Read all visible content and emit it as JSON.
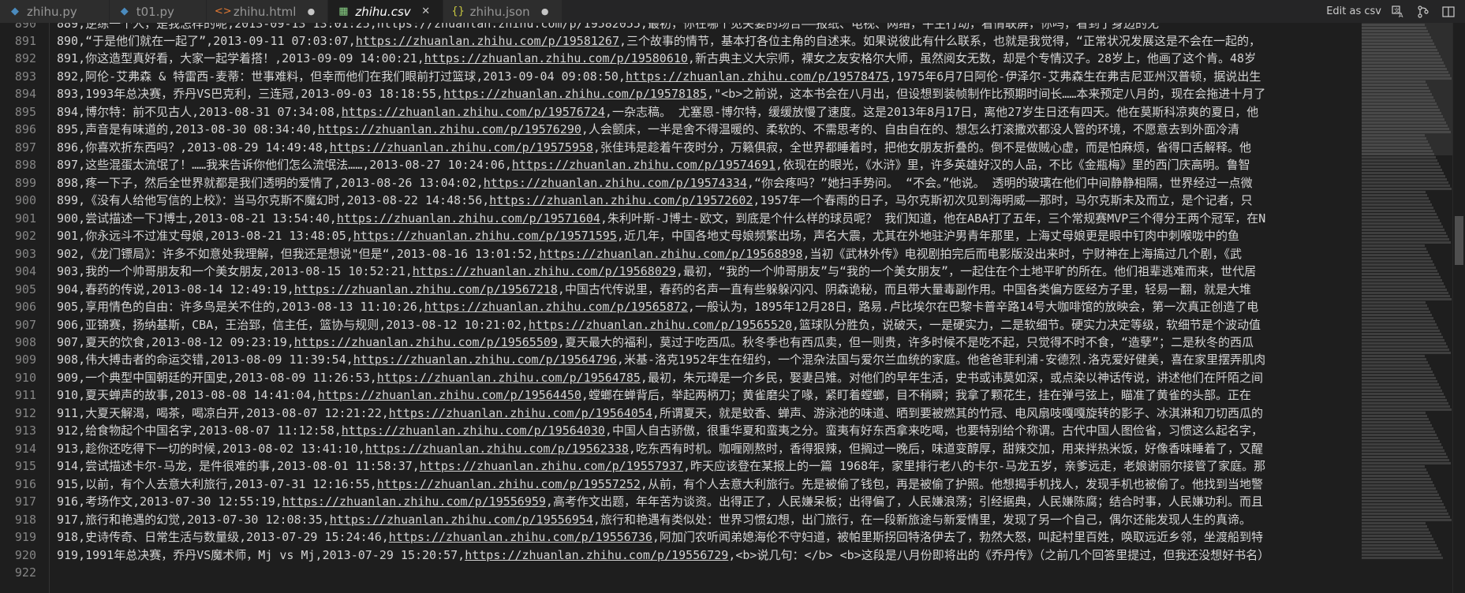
{
  "tabs": [
    {
      "label": "zhihu.py",
      "icon": "python-icon",
      "icon_glyph": "◆",
      "icon_color": "#4b8bbe",
      "state": "",
      "active": false
    },
    {
      "label": "t01.py",
      "icon": "python-icon",
      "icon_glyph": "◆",
      "icon_color": "#4b8bbe",
      "state": "",
      "active": false
    },
    {
      "label": "zhihu.html",
      "icon": "html-icon",
      "icon_glyph": "<>",
      "icon_color": "#e37933",
      "state": "●",
      "active": false
    },
    {
      "label": "zhihu.csv",
      "icon": "csv-icon",
      "icon_glyph": "▦",
      "icon_color": "#89d185",
      "state": "✕",
      "active": true
    },
    {
      "label": "zhihu.json",
      "icon": "json-icon",
      "icon_glyph": "{}",
      "icon_color": "#cbcb41",
      "state": "●",
      "active": false
    }
  ],
  "toolbar": {
    "edit_as_csv": "Edit as csv",
    "icons": [
      "translate-icon",
      "go-to-file-icon",
      "split-editor-icon"
    ]
  },
  "colors": {
    "background": "#1e1e1e",
    "tabbar": "#252526",
    "line_numbers": "#858585",
    "text": "#d4d4d4"
  },
  "lines": [
    {
      "n": "891",
      "pre": "890,“于是他们就在一起了”,2013-09-11 07:03:07,",
      "url": "https://zhuanlan.zhihu.com/p/19581267",
      "post": ",三个故事的情节，基本打各位主角的自述来。如果说彼此有什么联系，也就是我觉得，“正常状况发展这是不会在一起的，"
    },
    {
      "n": "892",
      "pre": "891,你这造型真好看，大家一起学着搭！,2013-09-09 14:00:21,",
      "url": "https://zhuanlan.zhihu.com/p/19580610",
      "post": ",新古典主义大宗师，裸女之友安格尔大师，虽然阅女无数，却是个专情汉子。28岁上，他画了这个肯。48岁"
    },
    {
      "n": "893",
      "pre": "892,阿伦-艾弗森 & 特雷西-麦蒂：世事难料，但幸而他们在我们眼前打过篮球,2013-09-04 09:08:50,",
      "url": "https://zhuanlan.zhihu.com/p/19578475",
      "post": ",1975年6月7日阿伦-伊泽尔-艾弗森生在弗吉尼亚州汉普顿，据说出生"
    },
    {
      "n": "894",
      "pre": "893,1993年总决赛，乔丹VS巴克利，三连冠,2013-09-03 18:18:55,",
      "url": "https://zhuanlan.zhihu.com/p/19578185",
      "post": ",\"<b>之前说，这本书会在八月出，但设想到装帧制作比预期时间长……本来预定八月的，现在会拖进十月了"
    },
    {
      "n": "895",
      "pre": "894,博尔特：前不见古人,2013-08-31 07:34:08,",
      "url": "https://zhuanlan.zhihu.com/p/19576724",
      "post": ",一杂志稿。 尤塞恩-博尔特，缓缓放慢了速度。这是2013年8月17日，离他27岁生日还有四天。他在莫斯科凉爽的夏日，他"
    },
    {
      "n": "896",
      "pre": "895,声音是有味道的,2013-08-30 08:34:40,",
      "url": "https://zhuanlan.zhihu.com/p/19576290",
      "post": ",人会颤床，一半是舍不得温暖的、柔软的、不需思考的、自由自在的、想怎么打滚撒欢都没人管的环境，不愿意去到外面冷清"
    },
    {
      "n": "897",
      "pre": "896,你喜欢折东西吗？,2013-08-29 14:49:48,",
      "url": "https://zhuanlan.zhihu.com/p/19575958",
      "post": ",张佳玮是趁着午夜时分，万籁俱寂，全世界都睡着时，把他女朋友折叠的。倒不是做贼心虚，而是怕麻烦，省得口舌解释。他"
    },
    {
      "n": "898",
      "pre": "897,这些混蛋太流氓了！……我来告诉你他们怎么流氓法……,2013-08-27 10:24:06,",
      "url": "https://zhuanlan.zhihu.com/p/19574691",
      "post": ",依现在的眼光，《水浒》里，许多英雄好汉的人品，不比《金瓶梅》里的西门庆高明。鲁智"
    },
    {
      "n": "899",
      "pre": "898,疼一下子，然后全世界就都是我们透明的爱情了,2013-08-26 13:04:02,",
      "url": "https://zhuanlan.zhihu.com/p/19574334",
      "post": ",“你会疼吗？”她扫手势问。 “不会。”他说。 透明的玻璃在他们中间静静相隔，世界经过一点微"
    },
    {
      "n": "900",
      "pre": "899,《没有人给他写信的上校》：当马尔克斯不魔幻时,2013-08-22 14:48:56,",
      "url": "https://zhuanlan.zhihu.com/p/19572602",
      "post": ",1957年一个春雨的日子，马尔克斯初次见到海明威——那时，马尔克斯未及而立，是个记者，只"
    },
    {
      "n": "901",
      "pre": "900,尝试描述一下J博士,2013-08-21 13:54:40,",
      "url": "https://zhuanlan.zhihu.com/p/19571604",
      "post": ",朱利叶斯-J博士-欧文，到底是个什么样的球员呢？ 我们知道，他在ABA打了五年，三个常规赛MVP三个得分王两个冠军，在N"
    },
    {
      "n": "902",
      "pre": "901,你永远斗不过准丈母娘,2013-08-21 13:48:05,",
      "url": "https://zhuanlan.zhihu.com/p/19571595",
      "post": ",近几年，中国各地丈母娘频繁出场，声名大震，尤其在外地驻沪男青年那里，上海丈母娘更是眼中钉肉中刺喉咙中的鱼"
    },
    {
      "n": "903",
      "pre": "902,《龙门镖局》：许多不如意处我理解，但我还是想说\"但是“,2013-08-16 13:01:52,",
      "url": "https://zhuanlan.zhihu.com/p/19568898",
      "post": ",当初《武林外传》电视剧拍完后而电影版没出来时，宁财神在上海搞过几个剧，《武"
    },
    {
      "n": "904",
      "pre": "903,我的一个帅哥朋友和一个美女朋友,2013-08-15 10:52:21,",
      "url": "https://zhuanlan.zhihu.com/p/19568029",
      "post": ",最初，“我的一个帅哥朋友”与“我的一个美女朋友”，一起住在个土地平旷的所在。他们祖辈逃难而来，世代居"
    },
    {
      "n": "905",
      "pre": "904,春药的传说,2013-08-14 12:49:19,",
      "url": "https://zhuanlan.zhihu.com/p/19567218",
      "post": ",中国古代传说里，春药的名声一直有些躲躲闪闪、阴森诡秘，而且带大量毒副作用。中国各类偏方医经方子里，轻易一翻，就是大堆"
    },
    {
      "n": "906",
      "pre": "905,享用情色的自由：许多鸟是关不住的,2013-08-13 11:10:26,",
      "url": "https://zhuanlan.zhihu.com/p/19565872",
      "post": ",一般认为，1895年12月28日，路易.卢比埃尔在巴黎卡普辛路14号大咖啡馆的放映会，第一次真正创造了电"
    },
    {
      "n": "907",
      "pre": "906,亚锦赛，扬纳基斯，CBA，王治郅，信主任，篮协与规则,2013-08-12 10:21:02,",
      "url": "https://zhuanlan.zhihu.com/p/19565520",
      "post": ",篮球队分胜负，说破天，一是硬实力，二是软细节。硬实力决定等级，软细节是个波动值"
    },
    {
      "n": "908",
      "pre": "907,夏天的饮食,2013-08-12 09:23:19,",
      "url": "https://zhuanlan.zhihu.com/p/19565509",
      "post": ",夏天最大的福利，莫过于吃西瓜。秋冬季也有西瓜卖，但一则贵，许多时候不是吃不起，只觉得不时不食，“造孽”；二是秋冬的西瓜"
    },
    {
      "n": "909",
      "pre": "908,伟大搏击者的命运交错,2013-08-09 11:39:54,",
      "url": "https://zhuanlan.zhihu.com/p/19564796",
      "post": ",米基-洛克1952年生在纽约，一个混杂法国与爱尔兰血统的家庭。他爸爸菲利浦-安德烈.洛克爱好健美，喜在家里摆弄肌肉"
    },
    {
      "n": "910",
      "pre": "909,一个典型中国朝廷的开国史,2013-08-09 11:26:53,",
      "url": "https://zhuanlan.zhihu.com/p/19564785",
      "post": ",最初，朱元璋是一介乡民，娶妻吕雉。对他们的早年生活，史书或讳莫如深，或点染以神话传说，讲述他们在阡陌之间"
    },
    {
      "n": "911",
      "pre": "910,夏天蝉声的故事,2013-08-08 14:41:04,",
      "url": "https://zhuanlan.zhihu.com/p/19564450",
      "post": ",螳螂在蝉背后，举起两柄刀；黄雀磨尖了喙，紧盯着螳螂，目不稍瞬；我拿了颗花生，挂在弹弓弦上，瞄准了黄雀的头部。正在"
    },
    {
      "n": "912",
      "pre": "911,大夏天解渴，喝茶，喝凉白开,2013-08-07 12:21:22,",
      "url": "https://zhuanlan.zhihu.com/p/19564054",
      "post": ",所谓夏天，就是蚊香、蝉声、游泳池的味道、晒到要被燃其的竹冠、电风扇吱嘎嘎旋转的影子、冰淇淋和刀切西瓜的"
    },
    {
      "n": "913",
      "pre": "912,给食物起个中国名字,2013-08-07 11:12:58,",
      "url": "https://zhuanlan.zhihu.com/p/19564030",
      "post": ",中国人自古骄傲，很重华夏和蛮夷之分。蛮夷有好东西拿来吃喝，也要特别给个称谓。古代中国人图俭省，习惯这么起名字，"
    },
    {
      "n": "914",
      "pre": "913,趁你还吃得下一切的时候,2013-08-02 13:41:10,",
      "url": "https://zhuanlan.zhihu.com/p/19562338",
      "post": ",吃东西有时机。咖喱刚熬时，香得狠辣，但搁过一晚后，味道变醇厚，甜辣交加，用来拌热米饭，好像香味睡着了，又醒"
    },
    {
      "n": "915",
      "pre": "914,尝试描述卡尔-马龙，是件很难的事,2013-08-01 11:58:37,",
      "url": "https://zhuanlan.zhihu.com/p/19557937",
      "post": ",昨天应该登在某报上的一篇 1968年，家里排行老八的卡尔-马龙五岁，亲爹远走，老娘谢丽尔接管了家庭。那"
    },
    {
      "n": "916",
      "pre": "915,以前，有个人去意大利旅行,2013-07-31 12:16:55,",
      "url": "https://zhuanlan.zhihu.com/p/19557252",
      "post": ",从前，有个人去意大利旅行。先是被偷了钱包，再是被偷了护照。他想揭手机找人，发现手机也被偷了。他找到当地警"
    },
    {
      "n": "917",
      "pre": "916,考场作文,2013-07-30 12:55:19,",
      "url": "https://zhuanlan.zhihu.com/p/19556959",
      "post": ",高考作文出题，年年苦为谈资。出得正了，人民嫌呆板；出得偏了，人民嫌浪荡；引经据典，人民嫌陈腐；结合时事，人民嫌功利。而且"
    },
    {
      "n": "918",
      "pre": "917,旅行和艳遇的幻觉,2013-07-30 12:08:35,",
      "url": "https://zhuanlan.zhihu.com/p/19556954",
      "post": ",旅行和艳遇有类似处：世界习惯幻想，出门旅行，在一段新旅途与新爱情里，发现了另一个自己，偶尔还能发现人生的真谛。"
    },
    {
      "n": "919",
      "pre": "918,史诗传奇、日常生活与数量级,2013-07-29 15:24:46,",
      "url": "https://zhuanlan.zhihu.com/p/19556736",
      "post": ",阿加门农听闻弟媳海伦不守妇道，被帕里斯拐回特洛伊去了，勃然大怒，叫起村里百姓，唤取远近乡邻，坐渡船到特"
    },
    {
      "n": "920",
      "pre": "919,1991年总决赛，乔丹VS魔术师，Mj vs Mj,2013-07-29 15:20:57,",
      "url": "https://zhuanlan.zhihu.com/p/19556729",
      "post": ",<b>说几句：</b> <b>这段是八月份即将出的《乔丹传》（之前几个回答里提过，但我还没想好书名）"
    },
    {
      "n": "921",
      "pre": "",
      "url": "",
      "post": ""
    }
  ],
  "top_partial": {
    "n": "890",
    "text": "889,逆练一个人，是我怎样的呢,2013-09-13 13:01:25,https://zhuanlan.zhihu.com/p/19582055,最初，你在哪个见关要的场合——报纸、电视、网络，平生行动，看情联屏，你吗，看到了身边的无"
  },
  "bottom_line": "922"
}
